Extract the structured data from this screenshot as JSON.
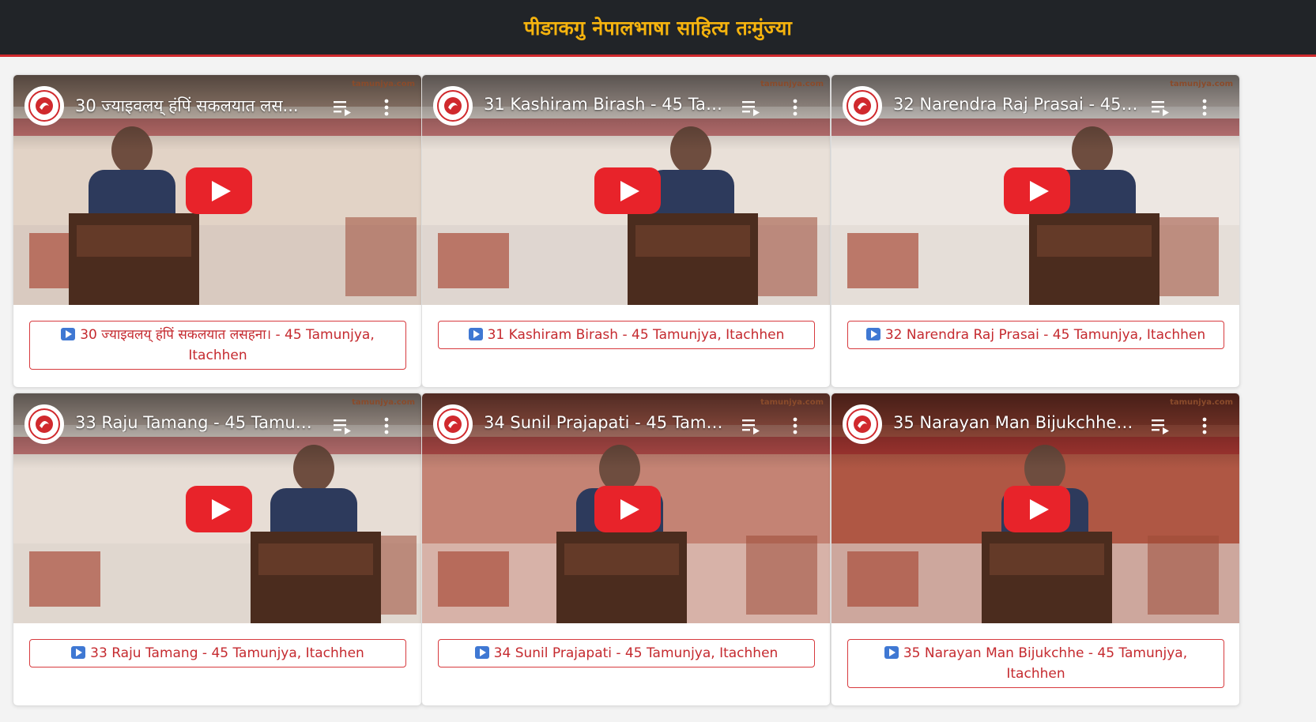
{
  "header": {
    "title": "पीङाकगु नेपालभाषा साहित्य तःमुंज्या"
  },
  "watermark": "tamunjya.com",
  "videos": [
    {
      "title": "30 ज्याइवलय् हंपिं सकलयात लस...",
      "button_label": "30 ज्याइवलय् हंपिं सकलयात लसहना। - 45 Tamunjya, Itachhen",
      "bg": "#b99c8a",
      "stage": "#e9ddd0"
    },
    {
      "title": "31 Kashiram Birash - 45 Tam...",
      "button_label": "31 Kashiram Birash - 45 Tamunjya, Itachhen",
      "bg": "#c8b9b1",
      "stage": "#efe6df"
    },
    {
      "title": "32 Narendra Raj Prasai - 45 T...",
      "button_label": "32 Narendra Raj Prasai - 45 Tamunjya, Itachhen",
      "bg": "#d8cdc6",
      "stage": "#f1ebe6"
    },
    {
      "title": "33 Raju Tamang - 45 Tamunj...",
      "button_label": "33 Raju Tamang - 45 Tamunjya, Itachhen",
      "bg": "#cbbbb0",
      "stage": "#ece3dc"
    },
    {
      "title": "34 Sunil Prajapati - 45 Tamu...",
      "button_label": "34 Sunil Prajapati - 45 Tamunjya, Itachhen",
      "bg": "#b3604f",
      "stage": "#c7897a"
    },
    {
      "title": "35 Narayan Man Bijukchhe - ...",
      "button_label": "35 Narayan Man Bijukchhe - 45 Tamunjya, Itachhen",
      "bg": "#9c4434",
      "stage": "#b35a48"
    }
  ],
  "icons": {
    "channel_logo": "channel-logo-icon",
    "play": "play-icon",
    "queue": "playlist-add-icon",
    "more": "more-vert-icon",
    "button_play": "play-square-icon"
  },
  "colors": {
    "header_bg": "#212428",
    "header_title": "#f5b30e",
    "header_border": "#d0292d",
    "button_border": "#d73a3e",
    "button_text": "#c52a2f",
    "play_red": "#e8232a"
  }
}
